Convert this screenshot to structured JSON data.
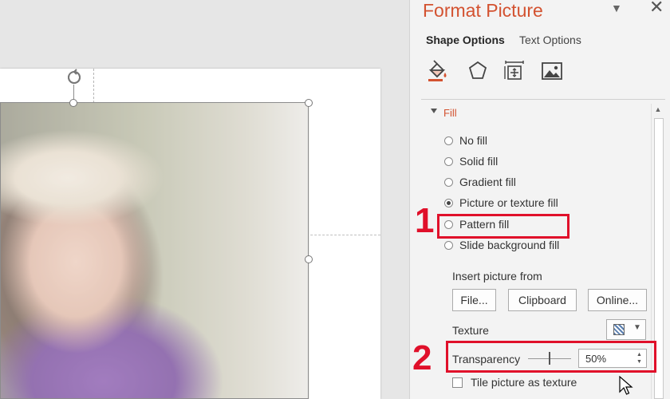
{
  "panel": {
    "title": "Format Picture",
    "dropdown_icon": "chevron-down-icon",
    "close_icon": "close-icon",
    "close_glyph": "✕",
    "tabs": [
      {
        "label": "Shape Options",
        "active": true
      },
      {
        "label": "Text Options",
        "active": false
      }
    ],
    "category_icons": [
      "fill-line-icon",
      "effects-icon",
      "size-properties-icon",
      "picture-icon"
    ]
  },
  "fill": {
    "header": "Fill",
    "options": [
      {
        "label": "No fill",
        "selected": false
      },
      {
        "label": "Solid fill",
        "selected": false
      },
      {
        "label": "Gradient fill",
        "selected": false
      },
      {
        "label": "Picture or texture fill",
        "selected": true
      },
      {
        "label": "Pattern fill",
        "selected": false
      },
      {
        "label": "Slide background fill",
        "selected": false
      }
    ],
    "insert_from_label": "Insert picture from",
    "buttons": {
      "file": "File...",
      "clipboard": "Clipboard",
      "online": "Online..."
    },
    "texture_label": "Texture",
    "transparency_label": "Transparency",
    "transparency_value": "50%",
    "transparency_level": 0.5,
    "tile_label": "Tile picture as texture",
    "tile_checked": false
  },
  "annotations": {
    "step1": "1",
    "step2": "2",
    "highlight_color": "#e0102a"
  },
  "colors": {
    "accent": "#d35230",
    "panel_bg": "#f3f3f3"
  }
}
